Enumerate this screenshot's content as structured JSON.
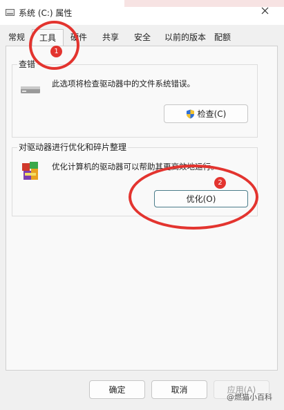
{
  "window": {
    "title": "系统 (C:) 属性"
  },
  "tabs": [
    {
      "label": "常规"
    },
    {
      "label": "工具"
    },
    {
      "label": "硬件"
    },
    {
      "label": "共享"
    },
    {
      "label": "安全"
    },
    {
      "label": "以前的版本"
    },
    {
      "label": "配额"
    }
  ],
  "active_tab": "工具",
  "error_check": {
    "group_title": "查错",
    "description": "此选项将检查驱动器中的文件系统错误。",
    "button_label": "检查(C)"
  },
  "optimize": {
    "group_title": "对驱动器进行优化和碎片整理",
    "description": "优化计算机的驱动器可以帮助其更高效地运行。",
    "button_label": "优化(O)"
  },
  "footer": {
    "ok_label": "确定",
    "cancel_label": "取消",
    "apply_label": "应用(A)"
  },
  "annotations": [
    {
      "number": "1"
    },
    {
      "number": "2"
    }
  ],
  "annotation_color": "#e3342f",
  "watermark": "@燃猫小百科",
  "icons": [
    "drive-window-icon",
    "close-icon",
    "drive-icon",
    "shield-icon",
    "defrag-icon"
  ]
}
